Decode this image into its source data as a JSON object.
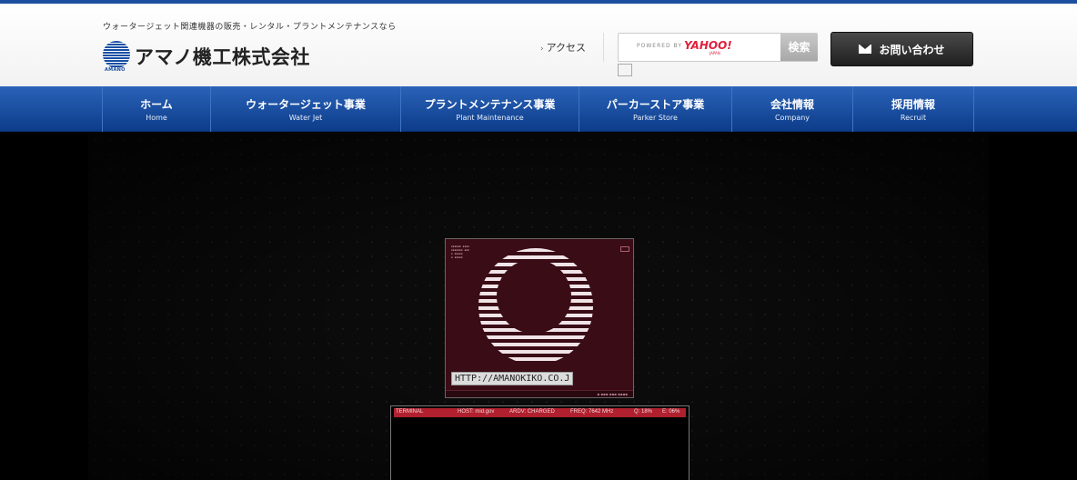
{
  "header": {
    "tagline": "ウォータージェット関連機器の販売・レンタル・プラントメンテナンスなら",
    "logo_text": "アマノ機工株式会社",
    "logo_brand": "AMANO",
    "access_label": "アクセス",
    "search": {
      "placeholder": "",
      "powered_by": "POWERED BY",
      "yahoo_label": "YAHOO!",
      "yahoo_sub": "JAPAN",
      "button_label": "検索"
    },
    "contact_label": "お問い合わせ"
  },
  "nav": {
    "items": [
      {
        "jp": "ホーム",
        "en": "Home"
      },
      {
        "jp": "ウォータージェット事業",
        "en": "Water Jet"
      },
      {
        "jp": "プラントメンテナンス事業",
        "en": "Plant Maintenance"
      },
      {
        "jp": "パーカーストア事業",
        "en": "Parker  Store"
      },
      {
        "jp": "会社情報",
        "en": "Company"
      },
      {
        "jp": "採用情報",
        "en": "Recruit"
      }
    ]
  },
  "hero": {
    "screen_url": "HTTP://AMANOKIKO.CO.J",
    "terminal": {
      "label": "TERMINAL",
      "host": "HOST: mid.gov",
      "ardv": "ARDV: CHARGED",
      "freq": "FREQ: 7642 MHz",
      "q": "Q: 18%",
      "e": "E: 06%"
    }
  },
  "colors": {
    "brand_blue": "#1c4fa0",
    "nav_top": "#2a63b8",
    "nav_bottom": "#0d3c8a",
    "terminal_red": "#b0202e"
  }
}
